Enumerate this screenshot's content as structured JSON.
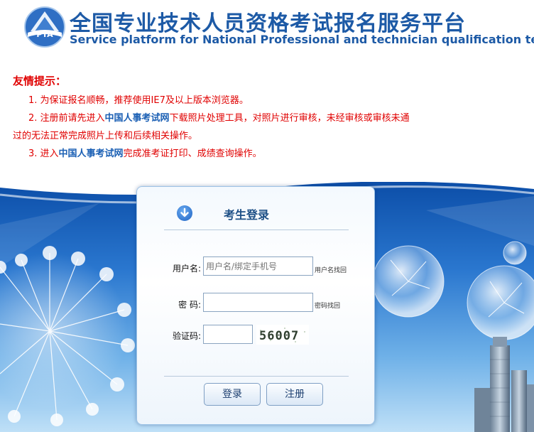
{
  "header": {
    "title_cn": "全国专业技术人员资格考试报名服务平台",
    "title_en": "Service platform for National Professional and technician qualification test",
    "logo_text": "PTA"
  },
  "notice": {
    "title": "友情提示：",
    "line1": "1. 为保证报名顺畅，推荐使用IE7及以上版本浏览器。",
    "line2_pre": "2. 注册前请先进入",
    "line2_link": "中国人事考试网",
    "line2_post": "下载照片处理工具，对照片进行审核，未经审核或审核未通",
    "line2_cont": "过的无法正常完成照片上传和后续相关操作。",
    "line3_pre": "3. 进入",
    "line3_link": "中国人事考试网",
    "line3_post": "完成准考证打印、成绩查询操作。"
  },
  "login": {
    "title": "考生登录",
    "username_label": "用户名:",
    "username_placeholder": "用户名/绑定手机号",
    "username_recover": "用户名找回",
    "password_label": "密 码:",
    "password_recover": "密码找回",
    "captcha_label": "验证码:",
    "captcha_text": "56007",
    "login_button": "登录",
    "register_button": "注册"
  },
  "colors": {
    "brand_blue": "#1d5aa6",
    "notice_red": "#e00000",
    "link_blue": "#1a5fb4"
  }
}
